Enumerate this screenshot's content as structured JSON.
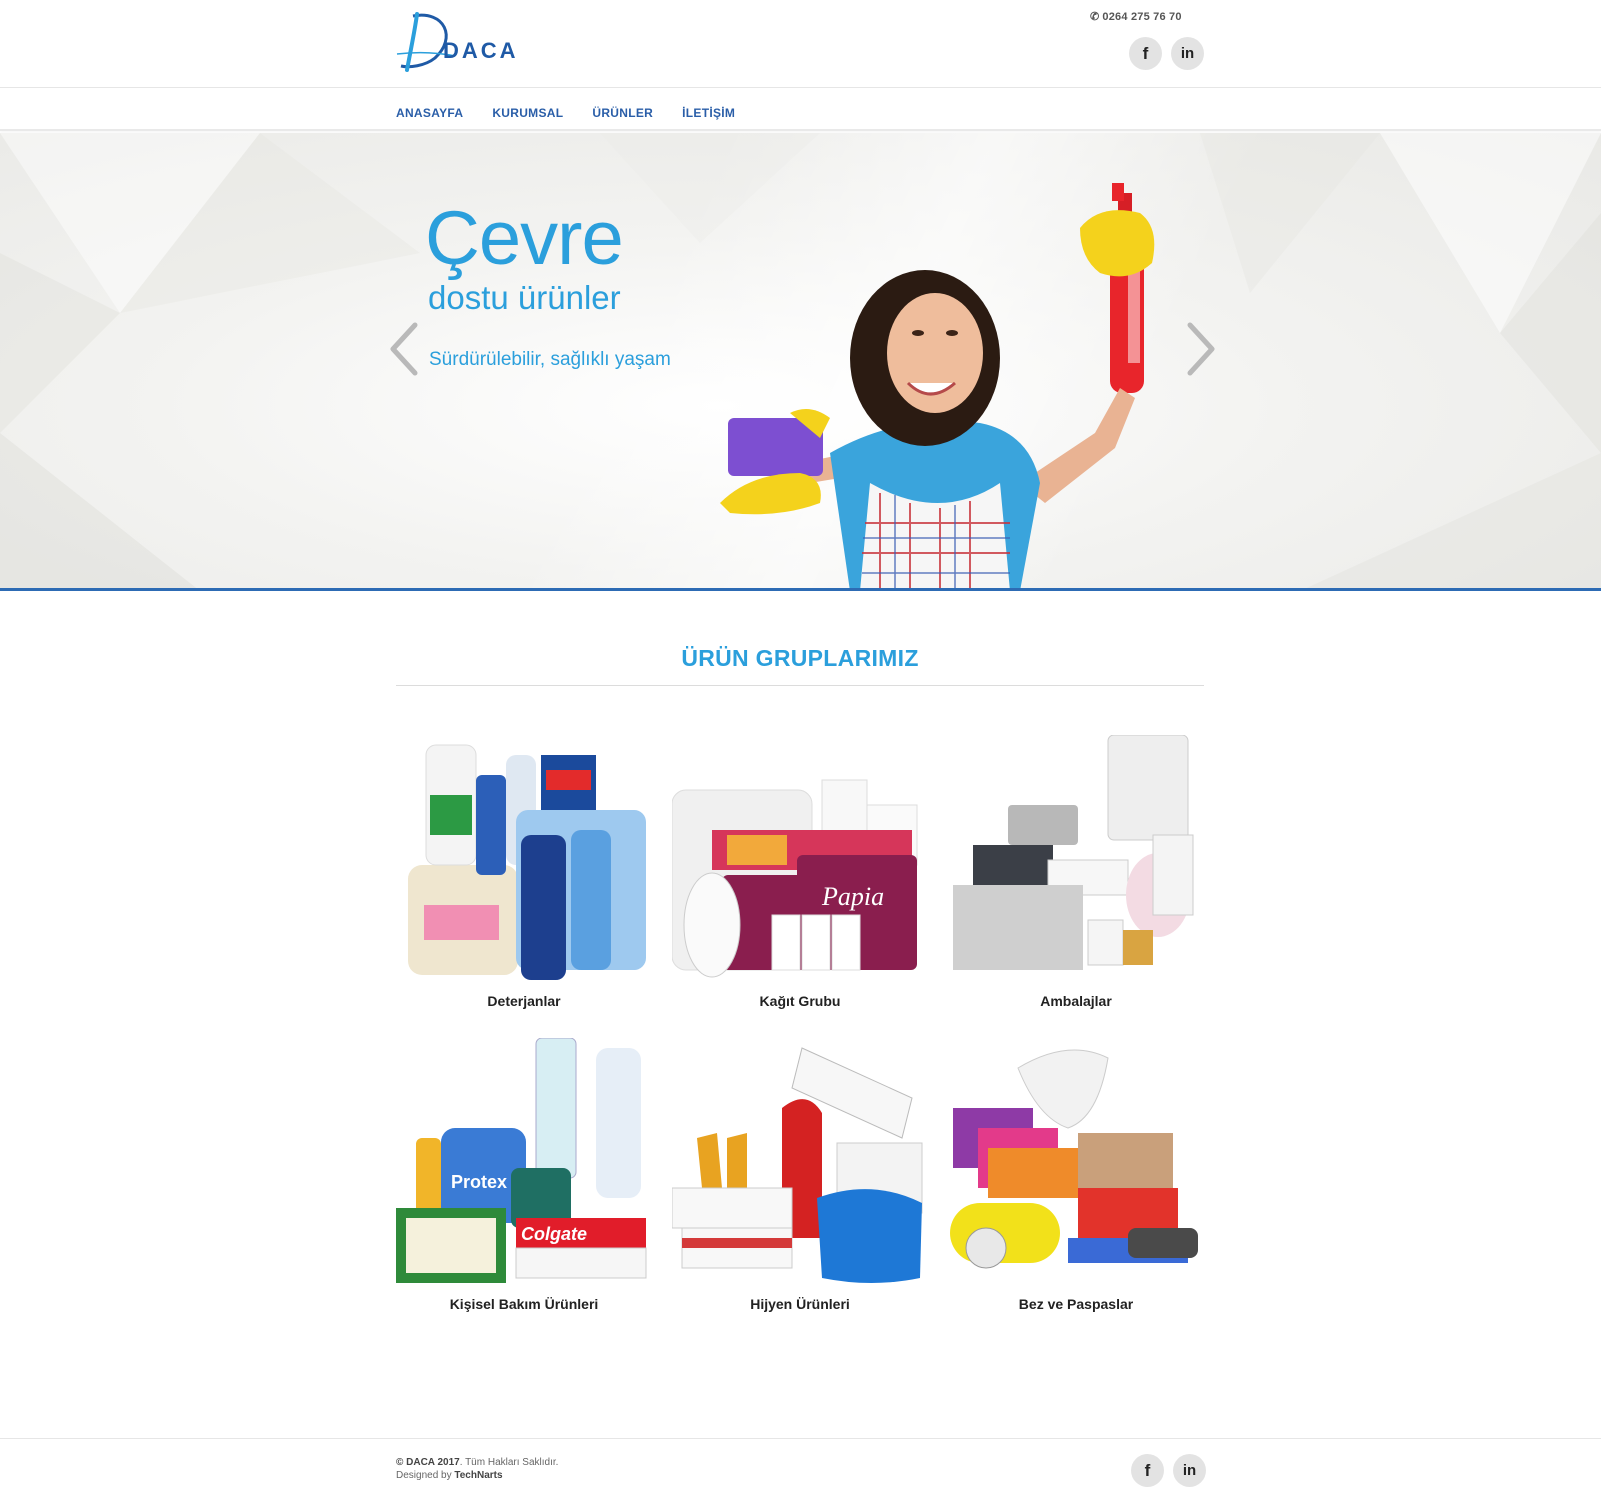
{
  "header": {
    "logo_text": "DACA",
    "phone": "0264 275 76 70",
    "social": {
      "facebook": "f",
      "linkedin": "in"
    }
  },
  "nav": {
    "items": [
      {
        "label": "ANASAYFA"
      },
      {
        "label": "KURUMSAL"
      },
      {
        "label": "ÜRÜNLER"
      },
      {
        "label": "İLETİŞİM"
      }
    ]
  },
  "hero": {
    "title": "Çevre",
    "subtitle": "dostu ürünler",
    "tagline": "Sürdürülebilir, sağlıklı yaşam"
  },
  "products_section": {
    "title": "ÜRÜN GRUPLARIMIZ",
    "items": [
      {
        "label": "Deterjanlar"
      },
      {
        "label": "Kağıt Grubu"
      },
      {
        "label": "Ambalajlar"
      },
      {
        "label": "Kişisel Bakım Ürünleri"
      },
      {
        "label": "Hijyen Ürünleri"
      },
      {
        "label": "Bez ve Paspaslar"
      }
    ]
  },
  "footer": {
    "copyright_brand": "© DACA 2017",
    "copyright_rest": ". Tüm Hakları Saklıdır.",
    "designed_prefix": "Designed by ",
    "designed_by": "TechNarts"
  },
  "colors": {
    "accent": "#2b9fdc",
    "nav": "#2a5ea8",
    "hero_border": "#2d6bb4"
  }
}
